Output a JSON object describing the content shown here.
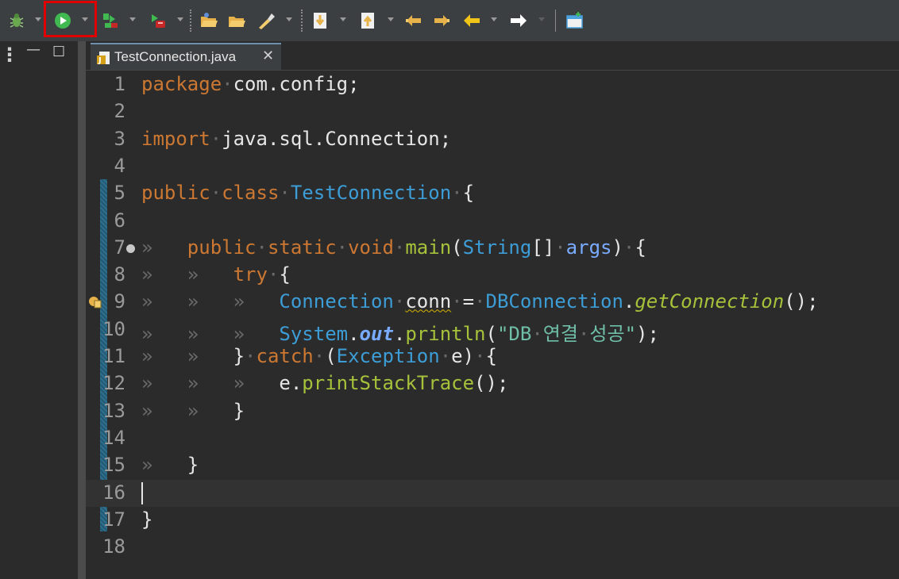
{
  "toolbar": {
    "items": [
      {
        "name": "debug-icon",
        "color": "#6aa84f"
      },
      {
        "name": "run-icon",
        "color": "#3fb950"
      },
      {
        "name": "coverage-icon",
        "color": "#3fb950"
      },
      {
        "name": "run-last-tool-icon",
        "color": "#c62828"
      },
      {
        "name": "open-type-icon",
        "color": "#e8b24a"
      },
      {
        "name": "open-task-icon",
        "color": "#e8b24a"
      },
      {
        "name": "search-icon",
        "color": "#e8b24a"
      },
      {
        "name": "next-annotation-icon",
        "color": "#e8b24a"
      },
      {
        "name": "previous-annotation-icon",
        "color": "#e8b24a"
      },
      {
        "name": "last-edit-location-icon",
        "color": "#e8b24a"
      },
      {
        "name": "back-icon",
        "color": "#e8b24a"
      },
      {
        "name": "forward-icon",
        "color": "#ffffff"
      },
      {
        "name": "new-window-icon",
        "color": "#4aa3df"
      }
    ]
  },
  "tab": {
    "label": "TestConnection.java",
    "close": "✕",
    "file_icon": "java-file-icon"
  },
  "side": {
    "menu": "⋮",
    "minimize": "—",
    "maximize": "☐"
  },
  "editor": {
    "current_line": 16,
    "lines": [
      {
        "n": "1",
        "tokens": [
          [
            "kw",
            "package"
          ],
          [
            "ws",
            "·"
          ],
          [
            "plain",
            "com.config;"
          ]
        ]
      },
      {
        "n": "2",
        "tokens": []
      },
      {
        "n": "3",
        "tokens": [
          [
            "kw",
            "import"
          ],
          [
            "ws",
            "·"
          ],
          [
            "plain",
            "java.sql.Connection;"
          ]
        ]
      },
      {
        "n": "4",
        "tokens": []
      },
      {
        "n": "5",
        "tokens": [
          [
            "kw",
            "public"
          ],
          [
            "ws",
            "·"
          ],
          [
            "kw",
            "class"
          ],
          [
            "ws",
            "·"
          ],
          [
            "type",
            "TestConnection"
          ],
          [
            "ws",
            "·"
          ],
          [
            "plain",
            "{"
          ]
        ]
      },
      {
        "n": "6",
        "tokens": []
      },
      {
        "n": "7",
        "fold": true,
        "tokens": [
          [
            "ws",
            "»   "
          ],
          [
            "kw",
            "public"
          ],
          [
            "ws",
            "·"
          ],
          [
            "kw",
            "static"
          ],
          [
            "ws",
            "·"
          ],
          [
            "kw",
            "void"
          ],
          [
            "ws",
            "·"
          ],
          [
            "method",
            "main"
          ],
          [
            "plain",
            "("
          ],
          [
            "type",
            "String"
          ],
          [
            "plain",
            "[]"
          ],
          [
            "ws",
            "·"
          ],
          [
            "param",
            "args"
          ],
          [
            "plain",
            ")"
          ],
          [
            "ws",
            "·"
          ],
          [
            "plain",
            "{"
          ]
        ]
      },
      {
        "n": "8",
        "tokens": [
          [
            "ws",
            "»   »   "
          ],
          [
            "kw",
            "try"
          ],
          [
            "ws",
            "·"
          ],
          [
            "plain",
            "{"
          ]
        ]
      },
      {
        "n": "9",
        "breakpoint": true,
        "tokens": [
          [
            "ws",
            "»   »   »   "
          ],
          [
            "type",
            "Connection"
          ],
          [
            "ws",
            "·"
          ],
          [
            "warnplain",
            "conn"
          ],
          [
            "ws",
            "·"
          ],
          [
            "plain",
            "="
          ],
          [
            "ws",
            "·"
          ],
          [
            "type",
            "DBConnection"
          ],
          [
            "plain",
            "."
          ],
          [
            "ital",
            "getConnection"
          ],
          [
            "plain",
            "();"
          ]
        ]
      },
      {
        "n": "10",
        "tokens": [
          [
            "ws",
            "»   »   »   "
          ],
          [
            "type",
            "System"
          ],
          [
            "plain",
            "."
          ],
          [
            "bolditalic",
            "out"
          ],
          [
            "plain",
            "."
          ],
          [
            "method",
            "println"
          ],
          [
            "plain",
            "("
          ],
          [
            "str",
            "\"DB"
          ],
          [
            "ws",
            "·"
          ],
          [
            "str",
            "연결"
          ],
          [
            "ws",
            "·"
          ],
          [
            "str",
            "성공\""
          ],
          [
            "plain",
            ");"
          ]
        ]
      },
      {
        "n": "11",
        "tokens": [
          [
            "ws",
            "»   »   "
          ],
          [
            "plain",
            "}"
          ],
          [
            "ws",
            "·"
          ],
          [
            "kw",
            "catch"
          ],
          [
            "ws",
            "·"
          ],
          [
            "plain",
            "("
          ],
          [
            "type",
            "Exception"
          ],
          [
            "ws",
            "·"
          ],
          [
            "plain",
            "e)"
          ],
          [
            "ws",
            "·"
          ],
          [
            "plain",
            "{"
          ]
        ]
      },
      {
        "n": "12",
        "tokens": [
          [
            "ws",
            "»   »   »   "
          ],
          [
            "plain",
            "e."
          ],
          [
            "method",
            "printStackTrace"
          ],
          [
            "plain",
            "();"
          ]
        ]
      },
      {
        "n": "13",
        "tokens": [
          [
            "ws",
            "»   »   "
          ],
          [
            "plain",
            "}"
          ]
        ]
      },
      {
        "n": "14",
        "tokens": []
      },
      {
        "n": "15",
        "tokens": [
          [
            "ws",
            "»   "
          ],
          [
            "plain",
            "}"
          ]
        ]
      },
      {
        "n": "16",
        "tokens": []
      },
      {
        "n": "17",
        "tokens": [
          [
            "plain",
            "}"
          ]
        ]
      },
      {
        "n": "18",
        "tokens": []
      }
    ]
  }
}
